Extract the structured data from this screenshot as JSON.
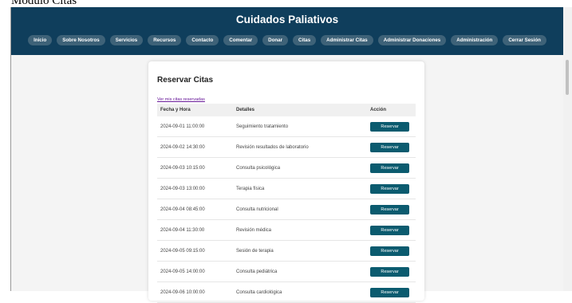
{
  "caption": "Modulo Citas",
  "header": {
    "title": "Cuidados Paliativos",
    "nav": [
      "Inicio",
      "Sobre Nosotros",
      "Servicios",
      "Recursos",
      "Contacto",
      "Comentar",
      "Donar",
      "Citas",
      "Administrar Citas",
      "Administrar Donaciones",
      "Administración",
      "Cerrar Sesión"
    ]
  },
  "card": {
    "title": "Reservar Citas",
    "link": "Ver mis citas reservadas",
    "columns": [
      "Fecha y Hora",
      "Detalles",
      "Acción"
    ],
    "rows": [
      {
        "datetime": "2024-09-01 11:00:00",
        "detail": "Seguimiento tratamiento",
        "action": "Reservar"
      },
      {
        "datetime": "2024-09-02 14:30:00",
        "detail": "Revisión resultados de laboratorio",
        "action": "Reservar"
      },
      {
        "datetime": "2024-09-03 10:15:00",
        "detail": "Consulta psicológica",
        "action": "Reservar"
      },
      {
        "datetime": "2024-09-03 13:00:00",
        "detail": "Terapia física",
        "action": "Reservar"
      },
      {
        "datetime": "2024-09-04 08:45:00",
        "detail": "Consulta nutricional",
        "action": "Reservar"
      },
      {
        "datetime": "2024-09-04 11:30:00",
        "detail": "Revisión médica",
        "action": "Reservar"
      },
      {
        "datetime": "2024-09-05 09:15:00",
        "detail": "Sesión de terapia",
        "action": "Reservar"
      },
      {
        "datetime": "2024-09-05 14:00:00",
        "detail": "Consulta pediátrica",
        "action": "Reservar"
      },
      {
        "datetime": "2024-09-06 10:00:00",
        "detail": "Consulta cardiológica",
        "action": "Reservar"
      }
    ]
  },
  "colors": {
    "header_bg": "#0f3e5c",
    "nav_pill": "#3e6278",
    "button": "#0b5b6f",
    "link": "#6a1b9a"
  }
}
